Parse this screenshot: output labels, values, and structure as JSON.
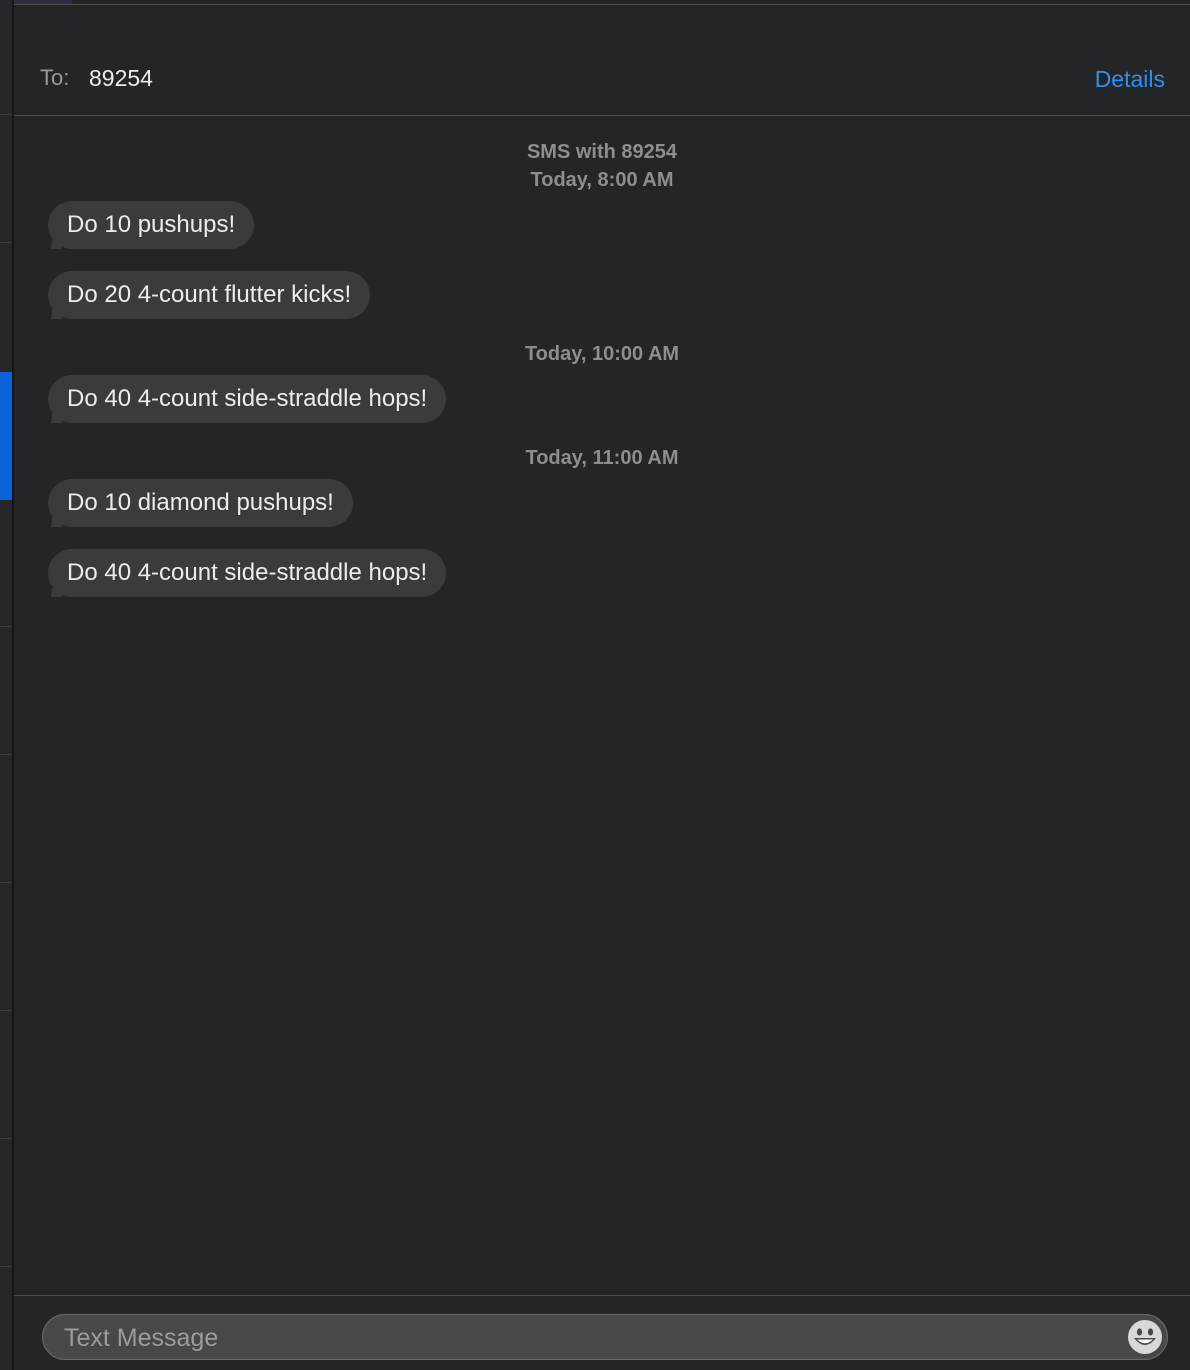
{
  "header": {
    "to_label": "To:",
    "recipient": "89254",
    "details_label": "Details"
  },
  "conversation": {
    "intro": "SMS with 89254",
    "groups": [
      {
        "timestamp": "Today, 8:00 AM",
        "messages": [
          "Do 10 pushups!",
          "Do 20 4-count flutter kicks!"
        ]
      },
      {
        "timestamp": "Today, 10:00 AM",
        "messages": [
          "Do 40 4-count side-straddle hops!"
        ]
      },
      {
        "timestamp": "Today, 11:00 AM",
        "messages": [
          "Do 10 diamond pushups!",
          "Do 40 4-count side-straddle hops!"
        ]
      }
    ]
  },
  "composer": {
    "placeholder": "Text Message",
    "value": "",
    "emoji_icon": "emoji-smiley-icon"
  },
  "colors": {
    "background": "#242527",
    "bubble": "#3b3b3e",
    "accent": "#2e8ff0",
    "sidebar_selected": "#0a64d8"
  }
}
